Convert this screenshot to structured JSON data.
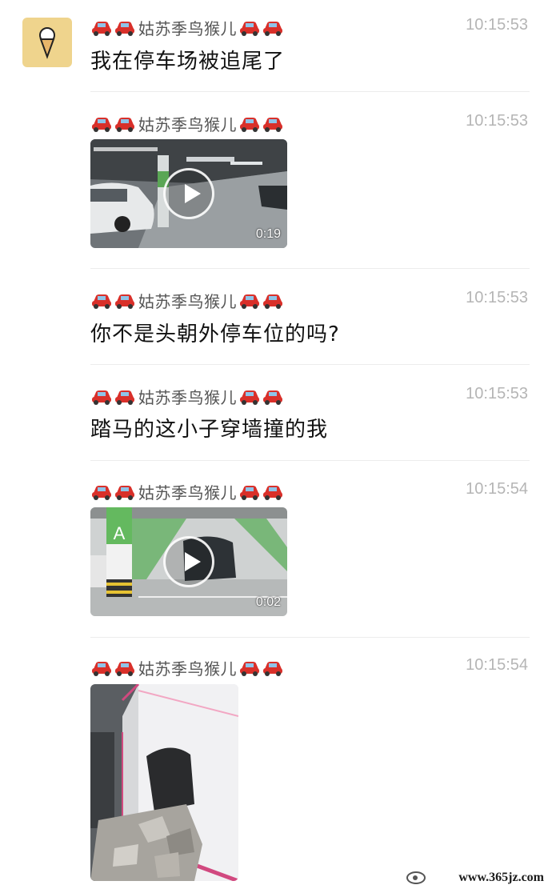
{
  "contact": {
    "name": "姑苏季鸟猴儿",
    "avatar": "ice-cream-icon"
  },
  "colors": {
    "car": "#d9302a",
    "avatar_bg": "#efd48d",
    "time": "#b5b5b5"
  },
  "messages": [
    {
      "type": "text",
      "sender": "姑苏季鸟猴儿",
      "time": "10:15:53",
      "text": "我在停车场被追尾了"
    },
    {
      "type": "video",
      "sender": "姑苏季鸟猴儿",
      "time": "10:15:53",
      "duration": "0:19"
    },
    {
      "type": "text",
      "sender": "姑苏季鸟猴儿",
      "time": "10:15:53",
      "text": "你不是头朝外停车位的吗?"
    },
    {
      "type": "text",
      "sender": "姑苏季鸟猴儿",
      "time": "10:15:53",
      "text": "踏马的这小子穿墙撞的我"
    },
    {
      "type": "video",
      "sender": "姑苏季鸟猴儿",
      "time": "10:15:54",
      "duration": "0:02",
      "sign_letter": "A"
    },
    {
      "type": "image",
      "sender": "姑苏季鸟猴儿",
      "time": "10:15:54"
    }
  ],
  "watermark": {
    "text": "www.365jz.com"
  }
}
